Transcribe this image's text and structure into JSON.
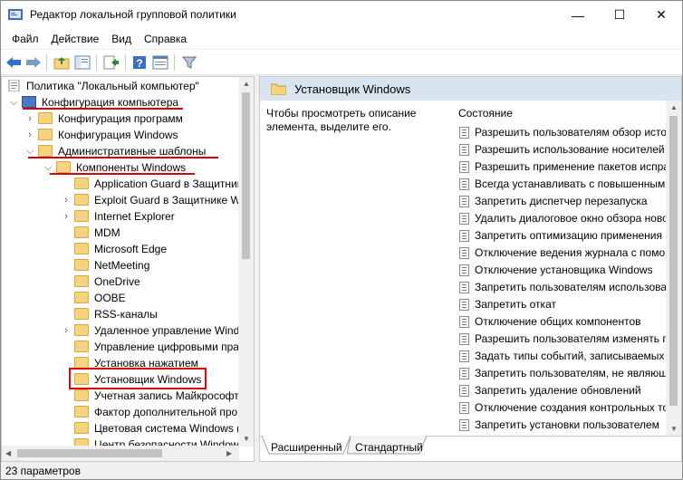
{
  "window": {
    "title": "Редактор локальной групповой политики",
    "controls": [
      "—",
      "☐",
      "✕"
    ]
  },
  "menu": [
    "Файл",
    "Действие",
    "Вид",
    "Справка"
  ],
  "tree": {
    "root": "Политика \"Локальный компьютер\"",
    "items": [
      {
        "label": "Конфигурация компьютера",
        "level": 1,
        "expander": "open",
        "icon": "computer-icon"
      },
      {
        "label": "Конфигурация программ",
        "level": 2,
        "expander": "closed",
        "icon": "folder-icon"
      },
      {
        "label": "Конфигурация Windows",
        "level": 2,
        "expander": "closed",
        "icon": "folder-icon"
      },
      {
        "label": "Административные шаблоны",
        "level": 2,
        "expander": "open",
        "icon": "folder-icon"
      },
      {
        "label": "Компоненты Windows",
        "level": 3,
        "expander": "open",
        "icon": "folder-icon"
      },
      {
        "label": "Application Guard в Защитник",
        "level": 4,
        "expander": "",
        "icon": "folder-icon"
      },
      {
        "label": "Exploit Guard в Защитнике W",
        "level": 4,
        "expander": "closed",
        "icon": "folder-icon"
      },
      {
        "label": "Internet Explorer",
        "level": 4,
        "expander": "closed",
        "icon": "folder-icon"
      },
      {
        "label": "MDM",
        "level": 4,
        "expander": "",
        "icon": "folder-icon"
      },
      {
        "label": "Microsoft Edge",
        "level": 4,
        "expander": "",
        "icon": "folder-icon"
      },
      {
        "label": "NetMeeting",
        "level": 4,
        "expander": "",
        "icon": "folder-icon"
      },
      {
        "label": "OneDrive",
        "level": 4,
        "expander": "",
        "icon": "folder-icon"
      },
      {
        "label": "OOBE",
        "level": 4,
        "expander": "",
        "icon": "folder-icon"
      },
      {
        "label": "RSS-каналы",
        "level": 4,
        "expander": "",
        "icon": "folder-icon"
      },
      {
        "label": "Удаленное управление Wind",
        "level": 4,
        "expander": "closed",
        "icon": "folder-icon"
      },
      {
        "label": "Управление цифровыми пра",
        "level": 4,
        "expander": "",
        "icon": "folder-icon"
      },
      {
        "label": "Установка нажатием",
        "level": 4,
        "expander": "",
        "icon": "folder-icon"
      },
      {
        "label": "Установщик Windows",
        "level": 4,
        "expander": "",
        "icon": "folder-icon"
      },
      {
        "label": "Учетная запись Майкрософт",
        "level": 4,
        "expander": "",
        "icon": "folder-icon"
      },
      {
        "label": "Фактор дополнительной пров",
        "level": 4,
        "expander": "",
        "icon": "folder-icon"
      },
      {
        "label": "Цветовая система Windows (",
        "level": 4,
        "expander": "",
        "icon": "folder-icon"
      },
      {
        "label": "Центр безопасности Windows",
        "level": 4,
        "expander": "",
        "icon": "folder-icon"
      }
    ]
  },
  "right": {
    "header": "Установщик Windows",
    "description": "Чтобы просмотреть описание элемента, выделите его.",
    "column": "Состояние",
    "items": [
      "Разрешить пользователям обзор исто",
      "Разрешить использование носителей",
      "Разрешить применение пакетов испра",
      "Всегда устанавливать с повышенным",
      "Запретить диспетчер перезапуска",
      "Удалить диалоговое окно обзора ново",
      "Запретить оптимизацию применения",
      "Отключение ведения журнала с помо",
      "Отключение установщика Windows",
      "Запретить пользователям использова",
      "Запретить откат",
      "Отключение общих компонентов",
      "Разрешить пользователям изменять п",
      "Задать типы событий, записываемых",
      "Запретить пользователям, не являющ",
      "Запретить удаление обновлений",
      "Отключение создания контрольных то",
      "Запретить установки пользователем"
    ],
    "tabs": [
      "Расширенный",
      "Стандартный"
    ]
  },
  "status": "23 параметров",
  "colors": {
    "highlight": "#e00000",
    "header_bg": "#d9e4f1",
    "folder": "#f6d37e"
  }
}
